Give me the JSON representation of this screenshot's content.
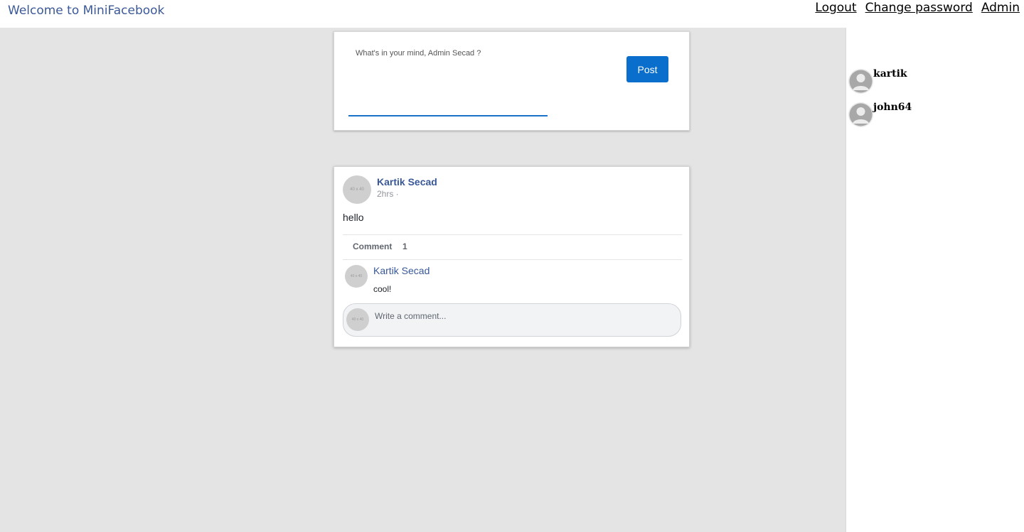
{
  "header": {
    "brand": "Welcome to MiniFacebook",
    "nav": {
      "logout": "Logout",
      "change_password": "Change password",
      "admin": "Admin"
    }
  },
  "composer": {
    "prompt": "What's in your mind, Admin Secad ?",
    "post_label": "Post",
    "input_value": ""
  },
  "post": {
    "avatar_text": "40 x 40",
    "author": "Kartik Secad",
    "time": "2hrs ·",
    "body": "hello",
    "comment_label": "Comment",
    "comment_count": "1",
    "comments": [
      {
        "avatar_text": "40 x 40",
        "author": "Kartik Secad",
        "text": "cool!"
      }
    ],
    "write_avatar_text": "40 x 40",
    "write_placeholder": "Write a comment..."
  },
  "friends": [
    {
      "name": "kartik",
      "icon": "user-silhouette-icon"
    },
    {
      "name": "john64",
      "icon": "user-silhouette-icon"
    }
  ],
  "colors": {
    "brand": "#3b5998",
    "post_button": "#0a6ecd",
    "link": "#385898",
    "background": "#e4e4e4"
  }
}
